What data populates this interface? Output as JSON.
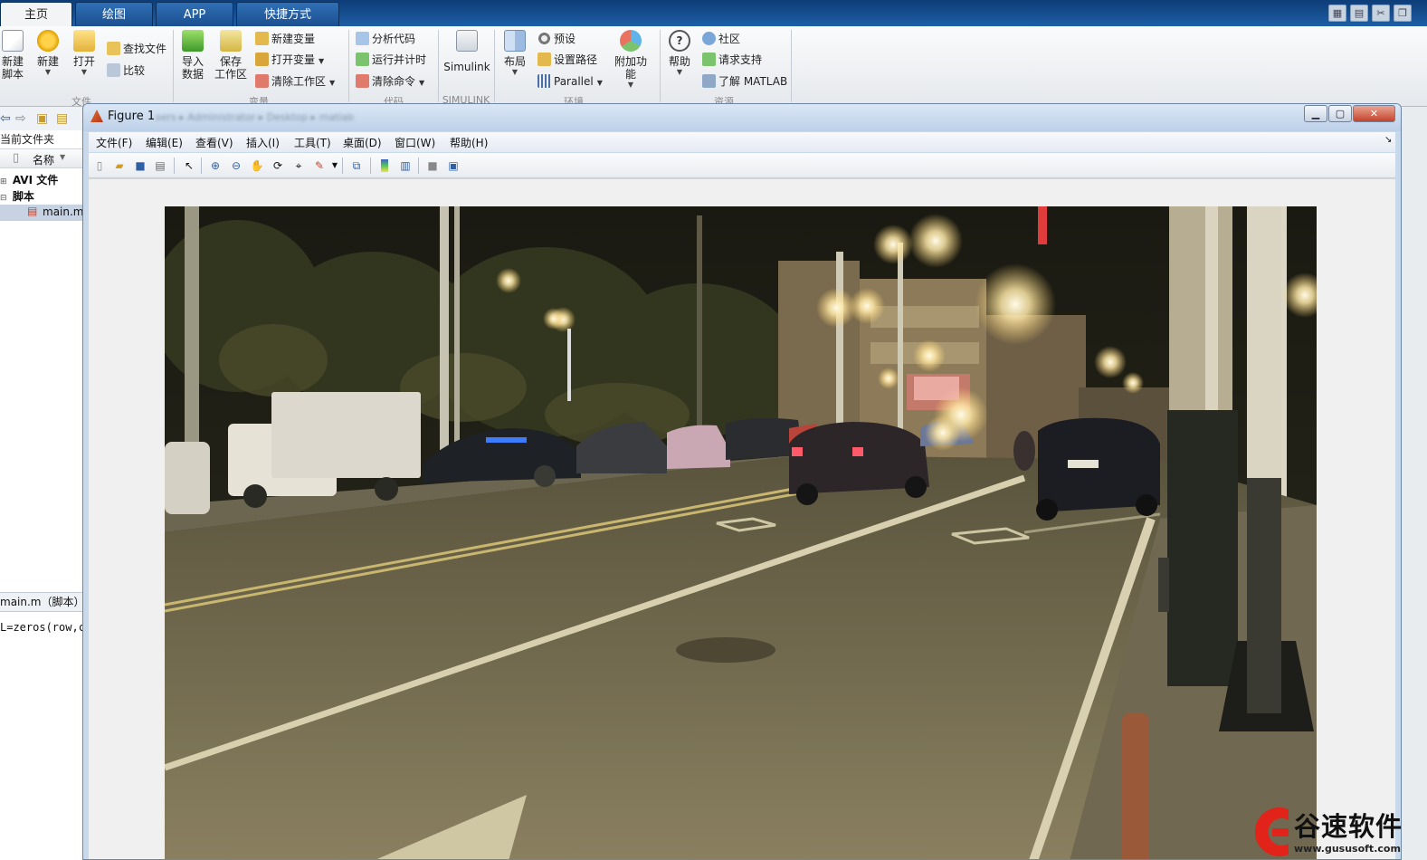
{
  "tabs": [
    {
      "label": "主页",
      "active": true
    },
    {
      "label": "绘图",
      "active": false
    },
    {
      "label": "APP",
      "active": false
    },
    {
      "label": "快捷方式",
      "active": false
    }
  ],
  "ribbon": {
    "file": {
      "new_script": "新建\n脚本",
      "new": "新建",
      "open": "打开",
      "find_files": "查找文件",
      "compare": "比较",
      "group_label": "文件"
    },
    "variable": {
      "import_data": "导入\n数据",
      "save_workspace": "保存\n工作区",
      "new_variable": "新建变量",
      "open_variable": "打开变量",
      "clear_workspace": "清除工作区",
      "group_label": "变量"
    },
    "code": {
      "analyze_code": "分析代码",
      "run_and_time": "运行并计时",
      "clear_commands": "清除命令",
      "group_label": "代码"
    },
    "simulink": {
      "simulink": "Simulink",
      "group_label": "SIMULINK"
    },
    "environment": {
      "layout": "布局",
      "preferences": "预设",
      "set_path": "设置路径",
      "parallel": "Parallel",
      "addons": "附加功能",
      "group_label": "环境"
    },
    "resources": {
      "help": "帮助",
      "community": "社区",
      "request_support": "请求支持",
      "learn_matlab": "了解 MATLAB",
      "group_label": "资源"
    }
  },
  "left_panel": {
    "title": "当前文件夹",
    "column_name": "名称",
    "tree": [
      {
        "label": "AVI 文件",
        "expanded": false
      },
      {
        "label": "脚本",
        "expanded": true
      }
    ],
    "selected_file": "main.m",
    "details_header": "main.m（脚本）",
    "code_line": "L=zeros(row,co"
  },
  "figure": {
    "title": "Figure 1",
    "path": "sers ▸ Administrator ▸ Desktop ▸ matlab",
    "menu": [
      "文件(F)",
      "编辑(E)",
      "查看(V)",
      "插入(I)",
      "工具(T)",
      "桌面(D)",
      "窗口(W)",
      "帮助(H)"
    ],
    "minimize_icon": "minimize-icon",
    "maximize_icon": "maximize-icon",
    "close_icon": "close-icon"
  },
  "watermark": {
    "brand": "谷速软件",
    "url": "www.gususoft.com",
    "color": "#e2231a"
  },
  "colors": {
    "topbar": "#1d5fa5",
    "ribbon": "#eef0f3",
    "figure_frame": "#c9d9ec",
    "canvas": "#f0f0f0"
  }
}
